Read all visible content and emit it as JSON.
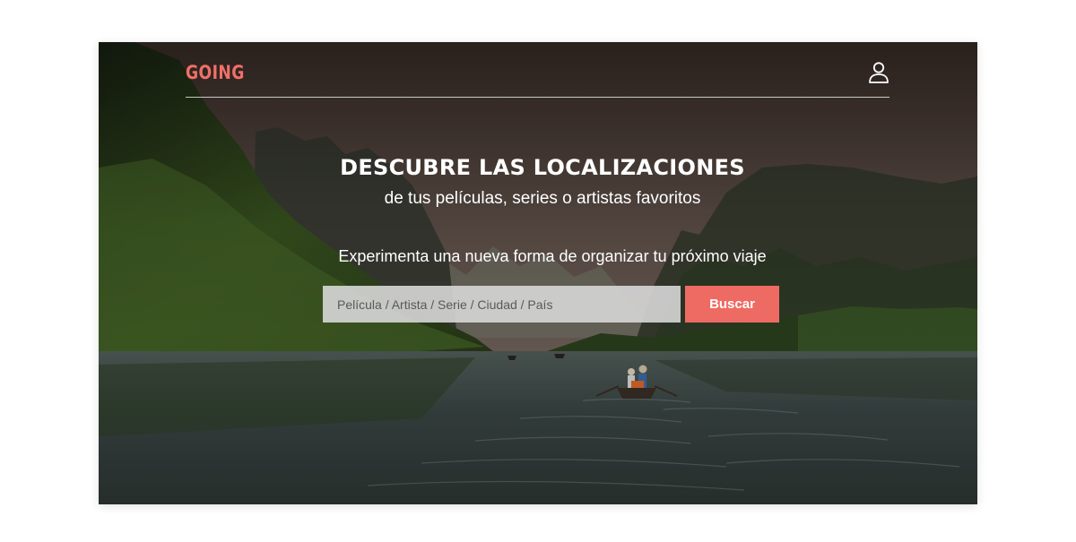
{
  "brand": {
    "logo_text": "GOING",
    "logo_color": "#f07068"
  },
  "header": {
    "user_icon": "user-icon"
  },
  "hero": {
    "title": "DESCUBRE LAS LOCALIZACIONES",
    "subtitle": "de tus películas, series o artistas favoritos",
    "tagline": "Experimenta una nueva forma de organizar tu próximo viaje"
  },
  "search": {
    "placeholder": "Película / Artista / Serie / Ciudad / País",
    "value": "",
    "button_label": "Buscar",
    "button_color": "#ee6b63"
  }
}
